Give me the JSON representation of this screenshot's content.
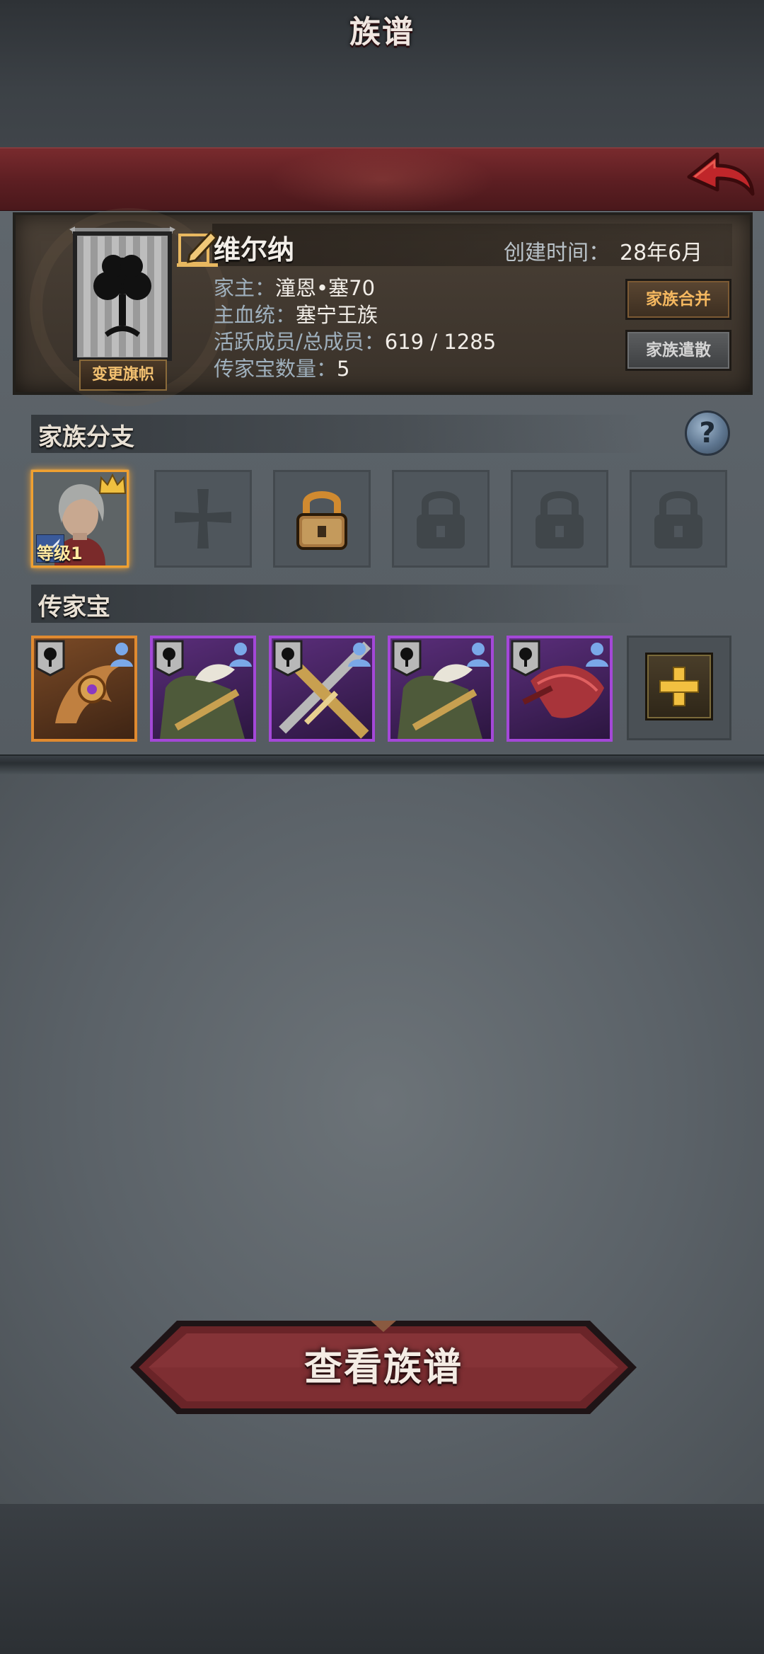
{
  "header": {
    "title": "族谱"
  },
  "family": {
    "name": "维尔纳",
    "created_label": "创建时间：",
    "created_value": "28年6月",
    "leader_label": "家主：",
    "leader_value": "潼恩•塞70",
    "bloodline_label": "主血统：",
    "bloodline_value": "塞宁王族",
    "members_label": "活跃成员/总成员：",
    "members_value": "619 / 1285",
    "heirlooms_label": "传家宝数量：",
    "heirlooms_value": "5",
    "change_banner_label": "变更旗帜",
    "merge_label": "家族合并",
    "disband_label": "家族遣散"
  },
  "branches": {
    "title": "家族分支",
    "help": "?",
    "member_level": "等级1"
  },
  "heirlooms": {
    "title": "传家宝"
  },
  "footer": {
    "view_label": "查看族谱"
  },
  "colors": {
    "header_red": "#5c1e22",
    "accent_gold": "#f0a030",
    "legendary": "#e08a30",
    "epic": "#a448d8"
  }
}
